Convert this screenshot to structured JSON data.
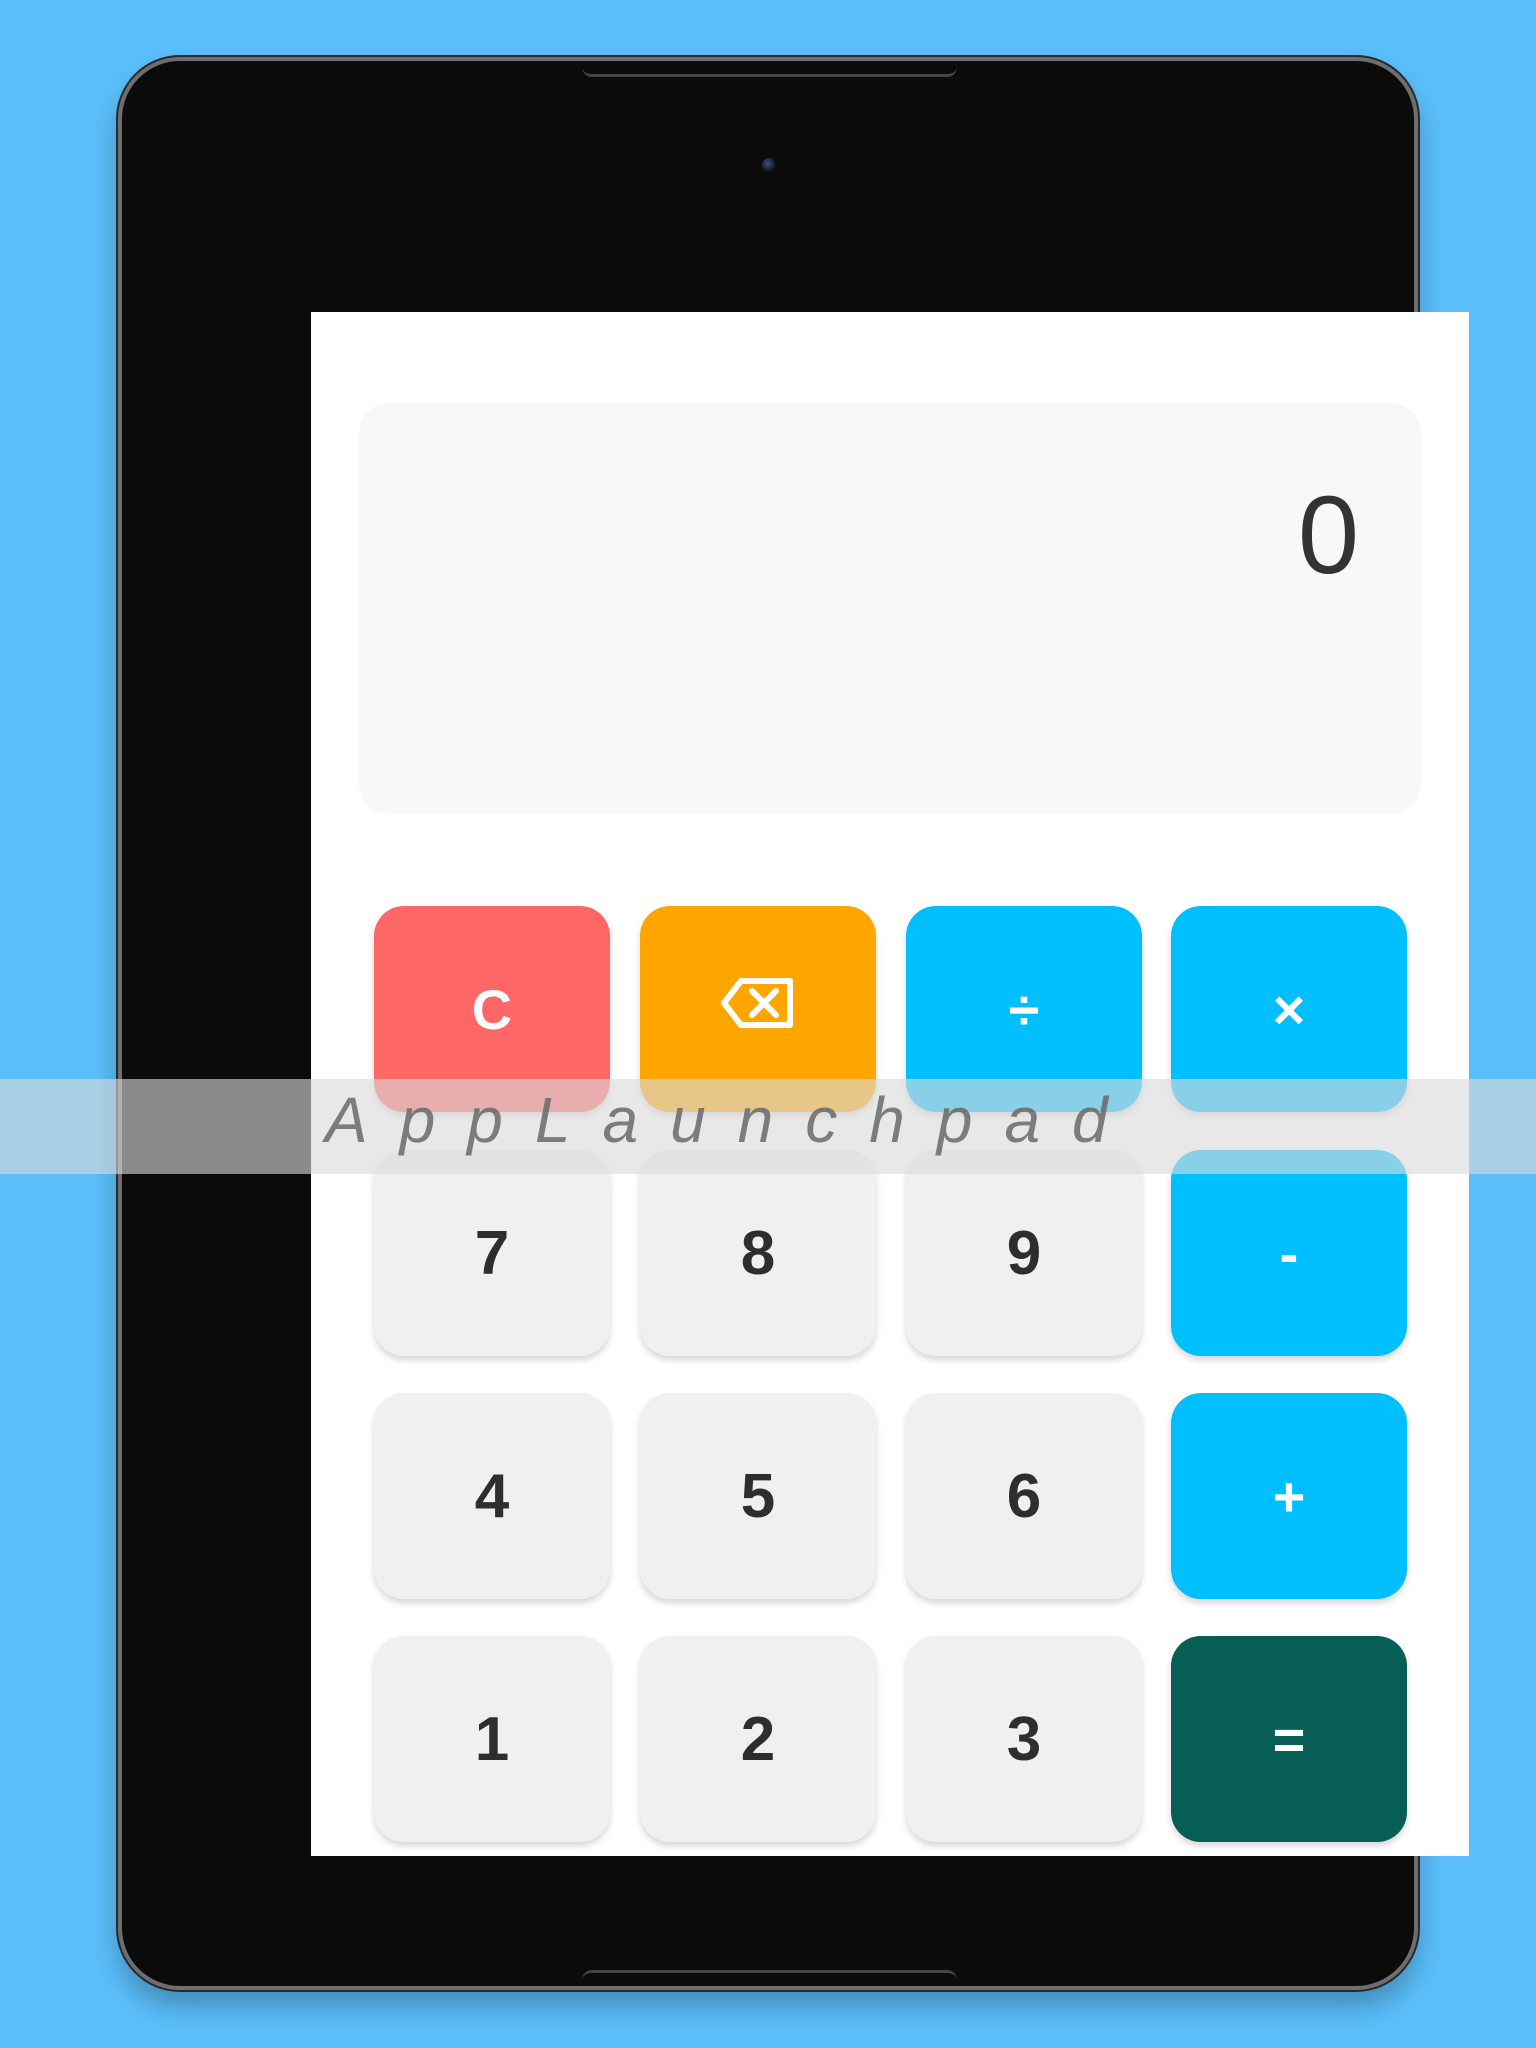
{
  "display": {
    "value": "0"
  },
  "keypad": {
    "clear": {
      "label": "C",
      "color": "#ff6666"
    },
    "backspace": {
      "icon": "backspace-icon",
      "color": "#ffa500"
    },
    "divide": {
      "label": "÷",
      "color": "#00bfff"
    },
    "multiply": {
      "label": "×",
      "color": "#00bfff"
    },
    "subtract": {
      "label": "-",
      "color": "#00bfff"
    },
    "add": {
      "label": "+",
      "color": "#00bfff"
    },
    "equals": {
      "label": "=",
      "color": "#075e54"
    },
    "digits": [
      "7",
      "8",
      "9",
      "4",
      "5",
      "6",
      "1",
      "2",
      "3"
    ]
  },
  "watermark": {
    "text": "AppLaunchpad"
  }
}
